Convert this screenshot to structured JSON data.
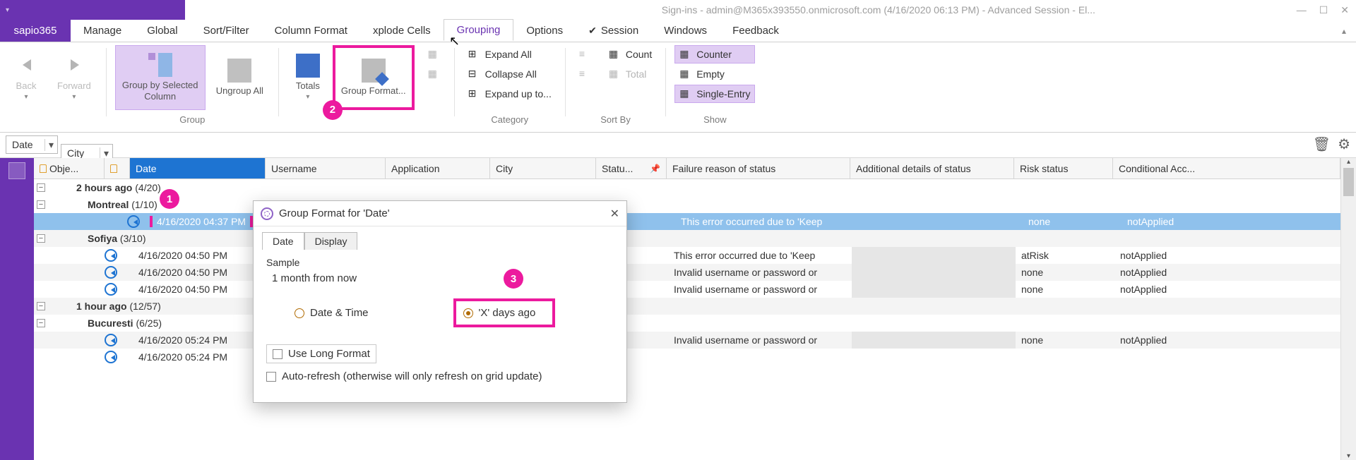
{
  "titlebar": {
    "text": "Sign-ins - admin@M365x393550.onmicrosoft.com (4/16/2020 06:13 PM) - Advanced Session - El..."
  },
  "app_button": "sapio365",
  "tabs": {
    "manage": "Manage",
    "global": "Global",
    "sortfilter": "Sort/Filter",
    "columnformat": "Column Format",
    "explodecells": "xplode Cells",
    "grouping": "Grouping",
    "options": "Options",
    "session": "Session",
    "windows": "Windows",
    "feedback": "Feedback"
  },
  "ribbon": {
    "back": "Back",
    "forward": "Forward",
    "group_by": "Group by Selected Column",
    "ungroup": "Ungroup All",
    "group_label": "Group",
    "totals": "Totals",
    "group_format": "Group Format...",
    "expand_all": "Expand All",
    "collapse_all": "Collapse All",
    "expand_up_to": "Expand up to...",
    "category_label": "Category",
    "count": "Count",
    "total": "Total",
    "sortby_label": "Sort By",
    "counter": "Counter",
    "empty": "Empty",
    "single_entry": "Single-Entry",
    "show_label": "Show"
  },
  "markers": {
    "m1": "1",
    "m2": "2",
    "m3": "3"
  },
  "filters": {
    "date": "Date",
    "city": "City"
  },
  "columns": {
    "obj": "Obje...",
    "date": "Date",
    "username": "Username",
    "application": "Application",
    "city": "City",
    "status": "Statu...",
    "failure": "Failure reason of status",
    "additional": "Additional details of status",
    "risk": "Risk status",
    "conditional": "Conditional Acc..."
  },
  "col_widths": {
    "obj": 88,
    "date": 192,
    "username": 170,
    "application": 148,
    "city": 150,
    "status": 80,
    "failure": 260,
    "additional": 232,
    "risk": 140,
    "conditional": 152
  },
  "groups": {
    "g1": "2 hours ago",
    "g1c": "(4/20)",
    "g1a": "Montreal",
    "g1ac": "(1/10)",
    "g1b": "Sofiya",
    "g1bc": "(3/10)",
    "g2": "1 hour ago",
    "g2c": "(12/57)",
    "g2a": "Bucuresti",
    "g2ac": "(6/25)"
  },
  "rows": {
    "r1_date": "4/16/2020 04:37 PM",
    "r1_fail": "This error occurred due to 'Keep",
    "r1_risk": "none",
    "r1_cond": "notApplied",
    "r2_date": "4/16/2020 04:50 PM",
    "r2_fail": "This error occurred due to 'Keep",
    "r2_risk": "atRisk",
    "r2_cond": "notApplied",
    "r3_date": "4/16/2020 04:50 PM",
    "r3_fail": "Invalid username or password or",
    "r3_risk": "none",
    "r3_cond": "notApplied",
    "r4_date": "4/16/2020 04:50 PM",
    "r4_fail": "Invalid username or password or",
    "r4_risk": "none",
    "r4_cond": "notApplied",
    "r5_date": "4/16/2020 05:24 PM",
    "r5_fail": "Invalid username or password or",
    "r5_risk": "none",
    "r5_cond": "notApplied",
    "r6_date": "4/16/2020 05:24 PM"
  },
  "dialog": {
    "title": "Group Format for 'Date'",
    "tab_date": "Date",
    "tab_display": "Display",
    "sample_label": "Sample",
    "sample_value": "1 month from now",
    "radio_dt": "Date & Time",
    "radio_days": "'X' days ago",
    "chk_long": "Use Long Format",
    "chk_refresh": "Auto-refresh (otherwise will only refresh on grid update)"
  }
}
